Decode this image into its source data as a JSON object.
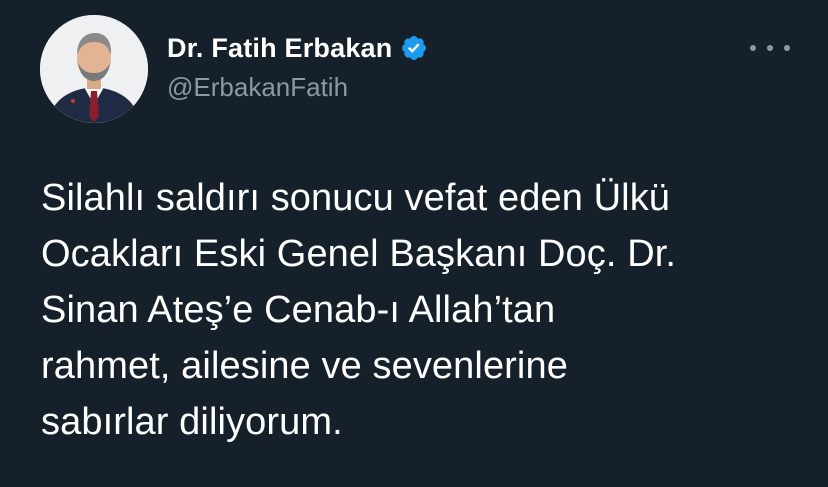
{
  "tweet": {
    "author": {
      "display_name": "Dr. Fatih Erbakan",
      "handle": "@ErbakanFatih",
      "verified": true,
      "avatar_icon": "profile-photo"
    },
    "more_icon": "more-horizontal-icon",
    "text_lines": [
      "Silahlı saldırı sonucu vefat eden Ülkü",
      "Ocakları Eski Genel Başkanı Doç. Dr.",
      "Sinan Ateş’e Cenab-ı Allah’tan",
      "rahmet, ailesine ve sevenlerine",
      "sabırlar diliyorum."
    ]
  },
  "colors": {
    "background": "#15202b",
    "text_primary": "#ffffff",
    "text_secondary": "#8b98a5",
    "verified_badge": "#1d9bf0"
  }
}
